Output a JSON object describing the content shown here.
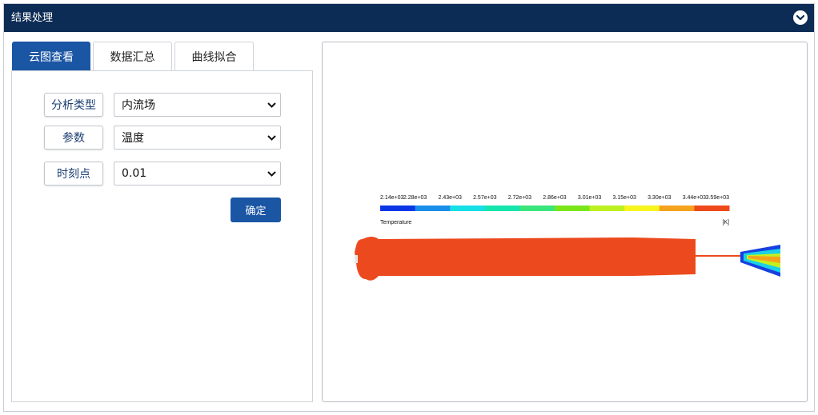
{
  "header": {
    "title": "结果处理",
    "collapse_icon": "chevron-down-circle-icon"
  },
  "tabs": [
    {
      "label": "云图查看",
      "active": true
    },
    {
      "label": "数据汇总",
      "active": false
    },
    {
      "label": "曲线拟合",
      "active": false
    }
  ],
  "form": {
    "analysis_type": {
      "label": "分析类型",
      "value": "内流场"
    },
    "parameter": {
      "label": "参数",
      "value": "温度"
    },
    "time_point": {
      "label": "时刻点",
      "value": "0.01"
    },
    "confirm_label": "确定"
  },
  "contour": {
    "ticks": [
      "2.14e+03",
      "2.28e+03",
      "2.43e+03",
      "2.57e+03",
      "2.72e+03",
      "2.86e+03",
      "3.01e+03",
      "3.15e+03",
      "3.30e+03",
      "3.44e+03",
      "3.59e+03"
    ],
    "bands": [
      "#0a36e6",
      "#1a8fea",
      "#16e0e6",
      "#16e6ad",
      "#3ae67c",
      "#7ae61a",
      "#bcf020",
      "#f7f51c",
      "#f5a21c",
      "#ee4a1c"
    ],
    "variable": "Temperature",
    "unit": "[K]",
    "body_color": "#ec4a1e"
  }
}
